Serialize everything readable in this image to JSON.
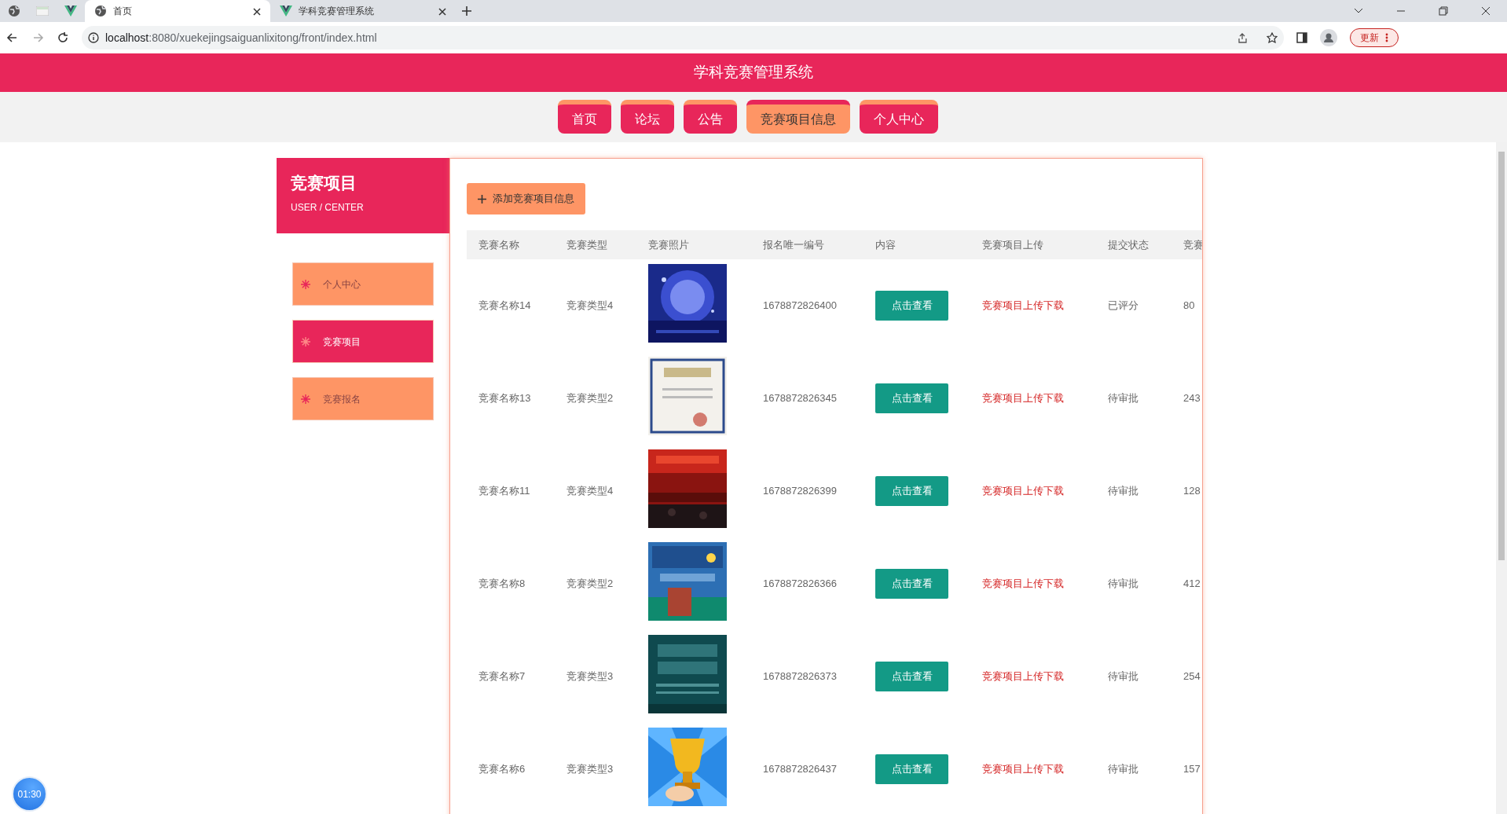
{
  "browser": {
    "tabs": [
      {
        "title": "首页",
        "selected": true
      },
      {
        "title": "学科竞赛管理系统",
        "selected": false
      }
    ],
    "address_host": "localhost",
    "address_rest": ":8080/xuekejingsaiguanlixitong/front/index.html",
    "update_button": "更新"
  },
  "site_title": "学科竞赛管理系统",
  "nav": [
    {
      "label": "首页",
      "selected": false
    },
    {
      "label": "论坛",
      "selected": false
    },
    {
      "label": "公告",
      "selected": false
    },
    {
      "label": "竞赛项目信息",
      "selected": true
    },
    {
      "label": "个人中心",
      "selected": false
    }
  ],
  "sidebar": {
    "title": "竞赛项目",
    "subtitle": "USER / CENTER",
    "items": [
      {
        "label": "个人中心",
        "selected": false
      },
      {
        "label": "竞赛项目",
        "selected": true
      },
      {
        "label": "竞赛报名",
        "selected": false
      }
    ]
  },
  "add_button": "添加竞赛项目信息",
  "table": {
    "columns": [
      "竞赛名称",
      "竞赛类型",
      "竞赛照片",
      "报名唯一编号",
      "内容",
      "竞赛项目上传",
      "提交状态",
      "竞赛"
    ],
    "rows": [
      {
        "name": "竞赛名称14",
        "type": "竞赛类型4",
        "number": "1678872826400",
        "view": "点击查看",
        "download": "竞赛项目上传下载",
        "status": "已评分",
        "column_8": "80"
      },
      {
        "name": "竞赛名称13",
        "type": "竞赛类型2",
        "number": "1678872826345",
        "view": "点击查看",
        "download": "竞赛项目上传下载",
        "status": "待审批",
        "column_8": "243"
      },
      {
        "name": "竞赛名称11",
        "type": "竞赛类型4",
        "number": "1678872826399",
        "view": "点击查看",
        "download": "竞赛项目上传下载",
        "status": "待审批",
        "column_8": "128"
      },
      {
        "name": "竞赛名称8",
        "type": "竞赛类型2",
        "number": "1678872826366",
        "view": "点击查看",
        "download": "竞赛项目上传下载",
        "status": "待审批",
        "column_8": "412"
      },
      {
        "name": "竞赛名称7",
        "type": "竞赛类型3",
        "number": "1678872826373",
        "view": "点击查看",
        "download": "竞赛项目上传下载",
        "status": "待审批",
        "column_8": "254"
      },
      {
        "name": "竞赛名称6",
        "type": "竞赛类型3",
        "number": "1678872826437",
        "view": "点击查看",
        "download": "竞赛项目上传下载",
        "status": "待审批",
        "column_8": "157"
      }
    ]
  },
  "timer": "01:30"
}
